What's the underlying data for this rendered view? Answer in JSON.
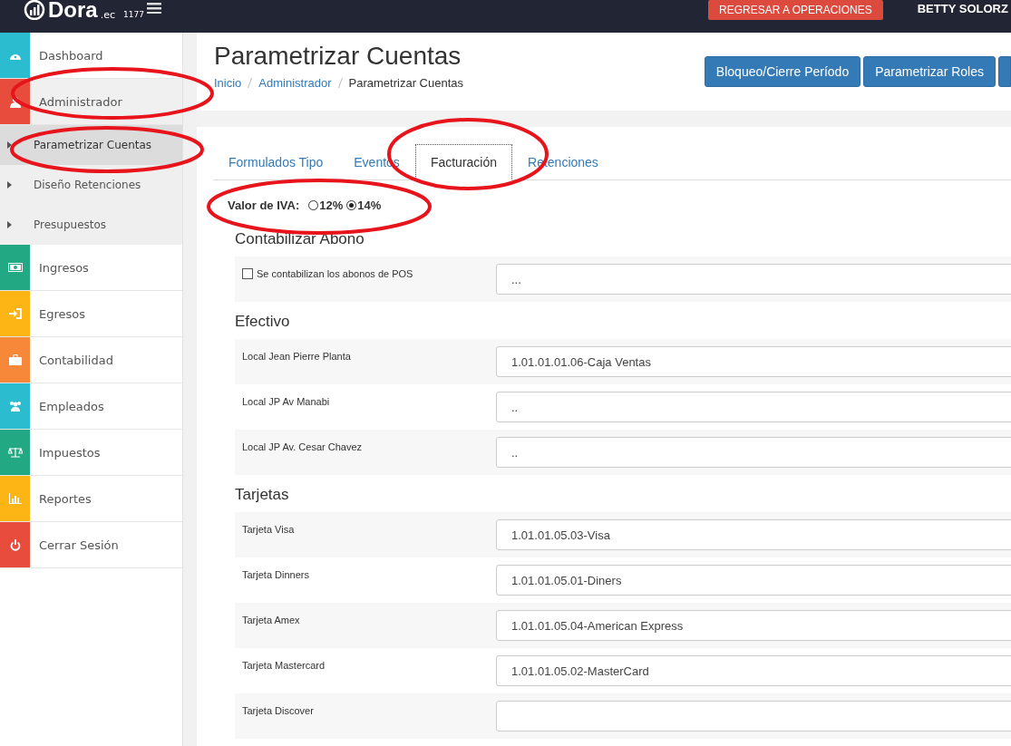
{
  "topbar": {
    "logo": "Dora",
    "logo_suffix": ".ec",
    "version": "1177",
    "button": "REGRESAR A OPERACIONES",
    "user": "BETTY SOLORZ"
  },
  "sidebar": {
    "items": [
      {
        "label": "Dashboard",
        "color": "#2bbcd0",
        "selected": false
      },
      {
        "label": "Administrador",
        "color": "#e74c3c",
        "selected": false,
        "expanded": true,
        "children": [
          {
            "label": "Parametrizar Cuentas",
            "selected": true
          },
          {
            "label": "Diseño Retenciones",
            "selected": false
          },
          {
            "label": "Presupuestos",
            "selected": false
          }
        ]
      },
      {
        "label": "Ingresos",
        "color": "#22a882",
        "selected": false
      },
      {
        "label": "Egresos",
        "color": "#fdb515",
        "selected": false
      },
      {
        "label": "Contabilidad",
        "color": "#f7883a",
        "selected": false
      },
      {
        "label": "Empleados",
        "color": "#2bbcd0",
        "selected": false
      },
      {
        "label": "Impuestos",
        "color": "#22a882",
        "selected": false
      },
      {
        "label": "Reportes",
        "color": "#fdb515",
        "selected": false
      },
      {
        "label": "Cerrar Sesión",
        "color": "#e74c3c",
        "selected": false
      }
    ]
  },
  "page": {
    "title": "Parametrizar Cuentas",
    "breadcrumb": [
      {
        "label": "Inicio",
        "link": true
      },
      {
        "label": "Administrador",
        "link": true
      },
      {
        "label": "Parametrizar Cuentas",
        "link": false
      }
    ],
    "buttons": [
      "Bloqueo/Cierre Período",
      "Parametrizar Roles"
    ]
  },
  "tabs": [
    {
      "label": "Formulados Tipo",
      "selected": false
    },
    {
      "label": "Eventos",
      "selected": false
    },
    {
      "label": "Facturación",
      "selected": true
    },
    {
      "label": "Retenciones",
      "selected": false
    }
  ],
  "iva": {
    "label": "Valor de IVA:",
    "options": [
      {
        "label": "12%",
        "selected": false
      },
      {
        "label": "14%",
        "selected": true
      }
    ]
  },
  "sections": [
    {
      "title": "Contabilizar Abono",
      "rows": [
        {
          "kind": "checkbox",
          "label": "Se contabilizan los abonos de POS",
          "checked": false,
          "value": "..."
        }
      ]
    },
    {
      "title": "Efectivo",
      "rows": [
        {
          "kind": "text",
          "label": "Local Jean Pierre Planta",
          "value": "1.01.01.01.06-Caja Ventas"
        },
        {
          "kind": "text",
          "label": "Local JP Av Manabi",
          "value": ".."
        },
        {
          "kind": "text",
          "label": "Local JP Av. Cesar Chavez",
          "value": ".."
        }
      ]
    },
    {
      "title": "Tarjetas",
      "rows": [
        {
          "kind": "text",
          "label": "Tarjeta Visa",
          "value": "1.01.01.05.03-Visa"
        },
        {
          "kind": "text",
          "label": "Tarjeta Dinners",
          "value": "1.01.01.05.01-Diners"
        },
        {
          "kind": "text",
          "label": "Tarjeta Amex",
          "value": "1.01.01.05.04-American Express"
        },
        {
          "kind": "text",
          "label": "Tarjeta Mastercard",
          "value": "1.01.01.05.02-MasterCard"
        },
        {
          "kind": "text",
          "label": "Tarjeta Discover",
          "value": ""
        }
      ]
    }
  ]
}
